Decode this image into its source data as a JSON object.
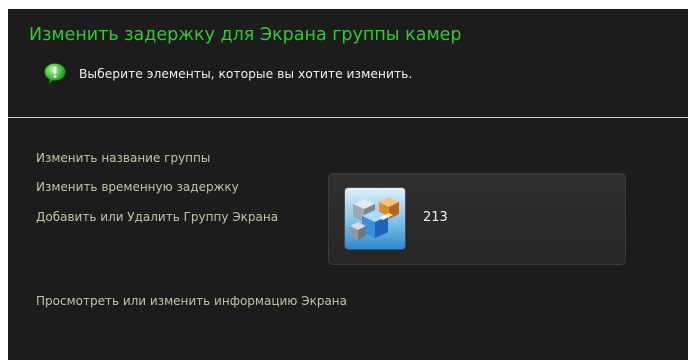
{
  "header": {
    "title": "Изменить задержку для Экрана группы камер",
    "hint_icon": "info-balloon-icon",
    "hint_text": "Выберите элементы, которые вы хотите изменить."
  },
  "tasks": {
    "rename_group": "Изменить название группы",
    "change_delay": "Изменить временную задержку",
    "add_remove_screen_group": "Добавить или Удалить Группу Экрана",
    "view_edit_screen_info": "Просмотреть или изменить информацию Экрана"
  },
  "group": {
    "icon": "camera-group-cubes-icon",
    "name": "213"
  },
  "colors": {
    "background": "#1c1c1c",
    "title": "#34c738",
    "link": "#c4c4a4",
    "text": "#f2f2f2",
    "hint_icon": "#3fbf3f"
  }
}
